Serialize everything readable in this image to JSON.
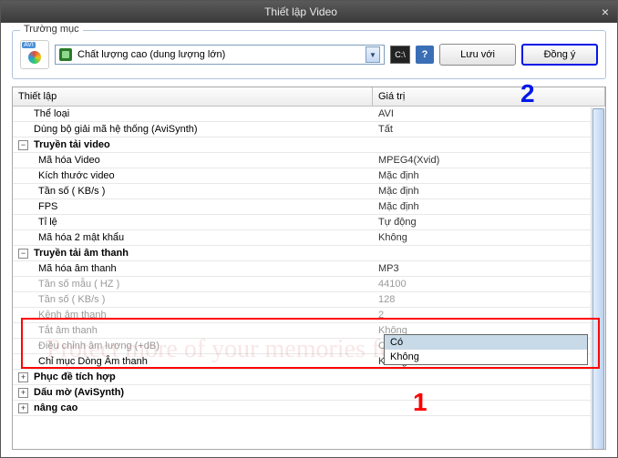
{
  "title": "Thiết lập Video",
  "fieldset_legend": "Trường mục",
  "avi_badge": "AVI",
  "quality_label": "Chất lượng cao (dung lượng lớn)",
  "cmd_icon_text": "C:\\",
  "help_icon_text": "?",
  "buttons": {
    "save_with": "Lưu với",
    "ok": "Đồng ý"
  },
  "columns": {
    "setting": "Thiết lập",
    "value": "Giá trị"
  },
  "rows": [
    {
      "label": "Thể loại",
      "value": "AVI",
      "indent": 0,
      "toggle": null,
      "bold": false
    },
    {
      "label": "Dùng bộ giải mã hệ thống (AviSynth)",
      "value": "Tất",
      "indent": 0,
      "toggle": null,
      "bold": false
    },
    {
      "label": "Truyền tải video",
      "value": "",
      "indent": 0,
      "toggle": "minus",
      "bold": true
    },
    {
      "label": "Mã hóa Video",
      "value": "MPEG4(Xvid)",
      "indent": 1,
      "toggle": null,
      "bold": false
    },
    {
      "label": "Kích thước video",
      "value": "Mặc định",
      "indent": 1,
      "toggle": null,
      "bold": false
    },
    {
      "label": "Tần số ( KB/s )",
      "value": "Mặc định",
      "indent": 1,
      "toggle": null,
      "bold": false
    },
    {
      "label": "FPS",
      "value": "Mặc định",
      "indent": 1,
      "toggle": null,
      "bold": false
    },
    {
      "label": "Tỉ lệ",
      "value": "Tự động",
      "indent": 1,
      "toggle": null,
      "bold": false
    },
    {
      "label": "Mã hóa 2 mật khẩu",
      "value": "Không",
      "indent": 1,
      "toggle": null,
      "bold": false
    },
    {
      "label": "Truyền tải âm thanh",
      "value": "",
      "indent": 0,
      "toggle": "minus",
      "bold": true
    },
    {
      "label": "Mã hóa âm thanh",
      "value": "MP3",
      "indent": 1,
      "toggle": null,
      "bold": false
    },
    {
      "label": "Tần số mẫu ( HZ )",
      "value": "44100",
      "indent": 1,
      "toggle": null,
      "bold": false,
      "dim": true
    },
    {
      "label": "Tần số ( KB/s )",
      "value": "128",
      "indent": 1,
      "toggle": null,
      "bold": false,
      "dim": true
    },
    {
      "label": "Kênh âm thanh",
      "value": "2",
      "indent": 1,
      "toggle": null,
      "bold": false,
      "dim": true
    },
    {
      "label": "Tắt âm thanh",
      "value": "Không",
      "indent": 1,
      "toggle": null,
      "bold": false,
      "dim": true,
      "active": true
    },
    {
      "label": "Điều chỉnh âm lượng (+dB)",
      "value": "Có",
      "indent": 1,
      "toggle": null,
      "bold": false,
      "dim": true
    },
    {
      "label": "Chỉ mục Dòng Âm thanh",
      "value": "Không",
      "indent": 1,
      "toggle": null,
      "bold": false
    },
    {
      "label": "Phục đề tích hợp",
      "value": "",
      "indent": 0,
      "toggle": "plus",
      "bold": true
    },
    {
      "label": "Dấu mờ (AviSynth)",
      "value": "",
      "indent": 0,
      "toggle": "plus",
      "bold": true
    },
    {
      "label": "nâng cao",
      "value": "",
      "indent": 0,
      "toggle": "plus",
      "bold": true
    }
  ],
  "dropdown": {
    "options": [
      "Có",
      "Không"
    ]
  },
  "annotations": {
    "num1": "1",
    "num2": "2"
  },
  "watermark": "Protect more of your memories for less"
}
